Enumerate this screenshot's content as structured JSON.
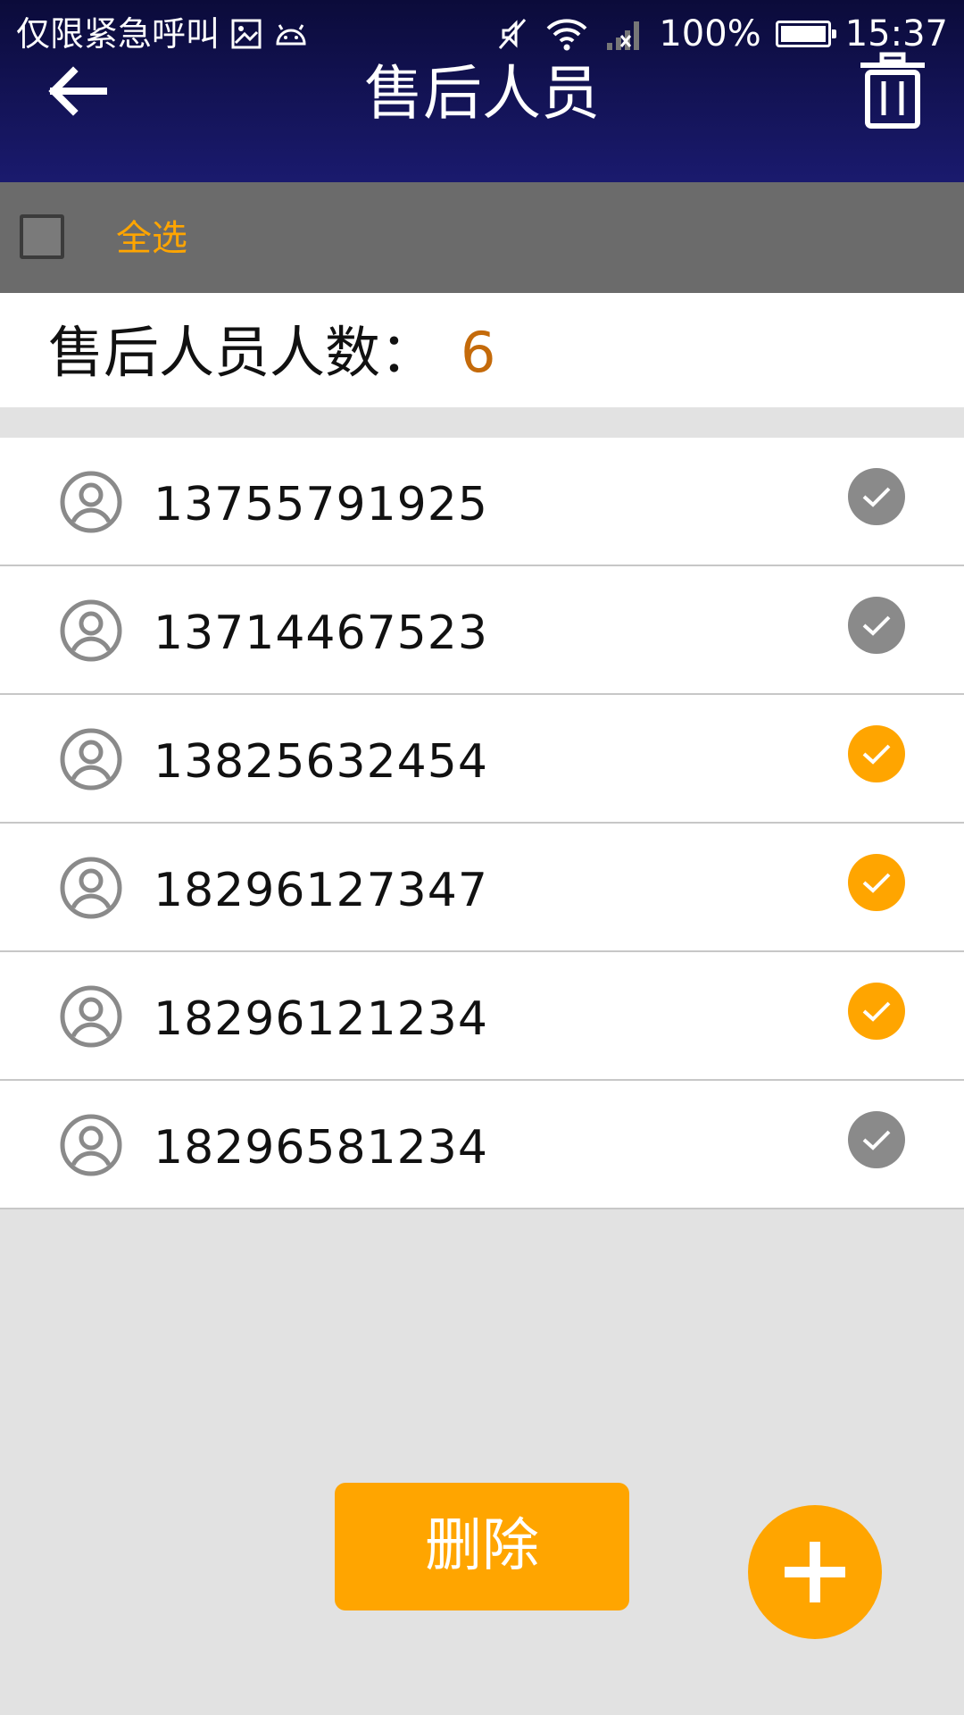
{
  "status_bar": {
    "carrier_text": "仅限紧急呼叫",
    "battery_text": "100%",
    "battery_level": 1.0,
    "time": "15:37"
  },
  "header": {
    "title": "售后人员",
    "back_icon": "arrow-left-icon",
    "trash_icon": "trash-icon"
  },
  "select_bar": {
    "select_all_label": "全选",
    "checked": false
  },
  "count": {
    "label": "售后人员人数：",
    "value": "6"
  },
  "list": {
    "items": [
      {
        "phone": "13755791925",
        "selected": false
      },
      {
        "phone": "13714467523",
        "selected": false
      },
      {
        "phone": "13825632454",
        "selected": true
      },
      {
        "phone": "18296127347",
        "selected": true
      },
      {
        "phone": "18296121234",
        "selected": true
      },
      {
        "phone": "18296581234",
        "selected": false
      }
    ]
  },
  "actions": {
    "delete_label": "删除",
    "add_icon": "plus-icon"
  },
  "colors": {
    "header": "#1a1a6e",
    "accent": "#ffa500",
    "count_value": "#c46a0a",
    "unchecked": "#8a8a8a"
  }
}
